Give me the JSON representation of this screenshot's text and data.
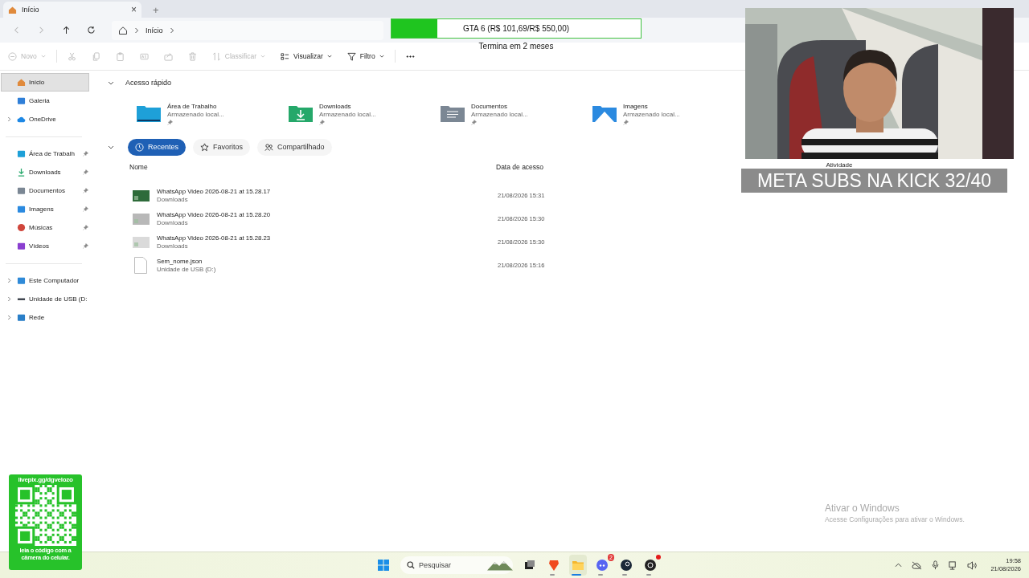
{
  "tab": {
    "title": "Início",
    "close": "×",
    "new_tab": "+"
  },
  "nav": [
    {
      "kind": "back",
      "disabled": true
    },
    {
      "kind": "forward",
      "disabled": true
    },
    {
      "kind": "up",
      "disabled": false
    },
    {
      "kind": "refresh",
      "disabled": false
    }
  ],
  "breadcrumb": [
    "Início"
  ],
  "toolbar": [
    {
      "kind": "new",
      "label": "Novo",
      "disabled": true,
      "dropdown": true
    },
    {
      "kind": "cut",
      "disabled": true,
      "dropdown": false
    },
    {
      "kind": "copy",
      "disabled": true,
      "dropdown": false
    },
    {
      "kind": "paste",
      "disabled": true,
      "dropdown": false
    },
    {
      "kind": "rename",
      "disabled": true,
      "dropdown": false
    },
    {
      "kind": "share",
      "disabled": true,
      "dropdown": false
    },
    {
      "kind": "delete",
      "disabled": true,
      "dropdown": false
    },
    {
      "kind": "sort",
      "label": "Classificar",
      "disabled": true,
      "dropdown": true
    },
    {
      "kind": "view",
      "label": "Visualizar",
      "disabled": false,
      "dropdown": true
    },
    {
      "kind": "filter",
      "label": "Filtro",
      "disabled": false,
      "dropdown": true
    },
    {
      "kind": "more",
      "disabled": false,
      "dropdown": false
    }
  ],
  "sidebar": {
    "sections": [
      {
        "items": [
          {
            "kind": "home",
            "label": "Início",
            "selected": true,
            "expandable": false,
            "pinned": false
          },
          {
            "kind": "gallery",
            "label": "Galeria",
            "selected": false,
            "expandable": false,
            "pinned": false
          },
          {
            "kind": "cloud",
            "label": "OneDrive",
            "selected": false,
            "expandable": true,
            "pinned": false
          }
        ]
      },
      {
        "items": [
          {
            "kind": "desktop",
            "label": "Área de Trabalh",
            "selected": false,
            "expandable": false,
            "pinned": true
          },
          {
            "kind": "downloads",
            "label": "Downloads",
            "selected": false,
            "expandable": false,
            "pinned": true
          },
          {
            "kind": "documents",
            "label": "Documentos",
            "selected": false,
            "expandable": false,
            "pinned": true
          },
          {
            "kind": "images",
            "label": "Imagens",
            "selected": false,
            "expandable": false,
            "pinned": true
          },
          {
            "kind": "music",
            "label": "Músicas",
            "selected": false,
            "expandable": false,
            "pinned": true
          },
          {
            "kind": "videos",
            "label": "Vídeos",
            "selected": false,
            "expandable": false,
            "pinned": true
          }
        ]
      },
      {
        "items": [
          {
            "kind": "pc",
            "label": "Este Computador",
            "selected": false,
            "expandable": true,
            "pinned": false
          },
          {
            "kind": "usb",
            "label": "Unidade de USB (D:",
            "selected": false,
            "expandable": true,
            "pinned": false
          },
          {
            "kind": "network",
            "label": "Rede",
            "selected": false,
            "expandable": true,
            "pinned": false
          }
        ]
      }
    ]
  },
  "quick_access": {
    "title": "Acesso rápido",
    "expanded": true,
    "items": [
      {
        "kind": "desktop",
        "name": "Área de Trabalho",
        "location": "Armazenado local...",
        "pinned": true
      },
      {
        "kind": "downloads",
        "name": "Downloads",
        "location": "Armazenado local...",
        "pinned": true
      },
      {
        "kind": "documents",
        "name": "Documentos",
        "location": "Armazenado local...",
        "pinned": true
      },
      {
        "kind": "images",
        "name": "Imagens",
        "location": "Armazenado local...",
        "pinned": true
      }
    ]
  },
  "filters": [
    {
      "kind": "recent",
      "label": "Recentes",
      "selected": true
    },
    {
      "kind": "favorites",
      "label": "Favoritos",
      "selected": false
    },
    {
      "kind": "shared",
      "label": "Compartilhado",
      "selected": false
    }
  ],
  "table": {
    "columns": [
      "Nome",
      "Data de acesso"
    ],
    "rows": [
      {
        "kind": "video-green",
        "name": "WhatsApp Video 2026-08-21 at 15.28.17",
        "location": "Downloads",
        "date": "21/08/2026 15:31"
      },
      {
        "kind": "video-grey",
        "name": "WhatsApp Video 2026-08-21 at 15.28.20",
        "location": "Downloads",
        "date": "21/08/2026 15:30"
      },
      {
        "kind": "video-light",
        "name": "WhatsApp Video 2026-08-21 at 15.28.23",
        "location": "Downloads",
        "date": "21/08/2026 15:30"
      },
      {
        "kind": "file",
        "name": "Sem_nome.json",
        "location": "Unidade de USB (D:)",
        "date": "21/08/2026 15:16"
      }
    ]
  },
  "goal": {
    "title": "GTA 6 (R$ 101,69/R$ 550,00)",
    "level": 0.185,
    "subtitle": "Termina em 2 meses"
  },
  "webcam": {
    "kind": "picture",
    "caption": "Atividade"
  },
  "banner": "META SUBS NA KICK 32/40",
  "qr": {
    "title": "livepix.gg/dgvelozo",
    "caption": "leia o código com a câmera do celular."
  },
  "activation": {
    "title": "Ativar o Windows",
    "text": "Acesse Configurações para ativar o Windows."
  },
  "taskbar": {
    "search_placeholder": "Pesquisar",
    "apps": [
      {
        "kind": "start",
        "selected": false
      },
      {
        "kind": "task-view",
        "selected": false
      },
      {
        "kind": "browser",
        "selected": false
      },
      {
        "kind": "files",
        "selected": true
      },
      {
        "kind": "chat",
        "selected": false,
        "badge": "2"
      },
      {
        "kind": "steam",
        "selected": false
      },
      {
        "kind": "recorder",
        "selected": false,
        "dot": true
      }
    ],
    "time": "19:58",
    "date": "21/08/2026"
  }
}
